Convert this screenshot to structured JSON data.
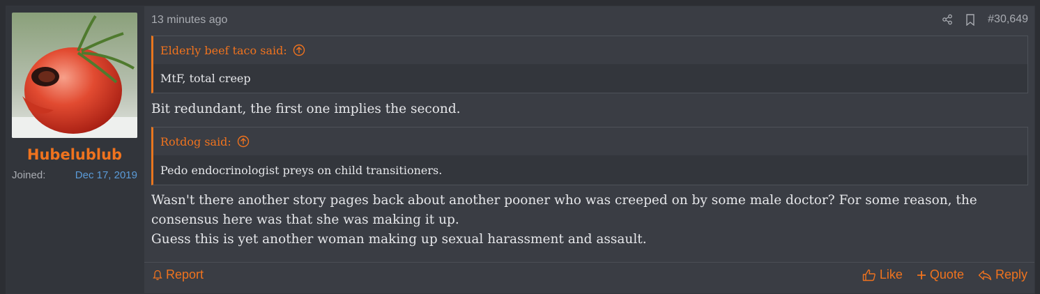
{
  "post": {
    "time": "13 minutes ago",
    "number": "#30,649",
    "icons": {
      "share": "share-icon",
      "bookmark": "bookmark-icon"
    },
    "user": {
      "name": "Hubelublub",
      "joined_label": "Joined:",
      "joined_date": "Dec 17, 2019",
      "avatar": "tomato-avatar"
    },
    "quotes": [
      {
        "author": "Elderly beef taco said:",
        "text": "MtF, total creep"
      },
      {
        "author": "Rotdog said:",
        "text": "Pedo endocrinologist preys on child transitioners."
      }
    ],
    "reply1": "Bit redundant, the first one implies the second.",
    "reply2_line1": "Wasn't there another story pages back about another pooner who was creeped on by some male doctor? For some reason, the",
    "reply2_line2": "consensus here was that she was making it up.",
    "reply2_line3": "Guess this is yet another woman making up sexual harassment and assault.",
    "footer": {
      "report": "Report",
      "like": "Like",
      "quote": "Quote",
      "reply": "Reply"
    },
    "colors": {
      "accent": "#f0731e",
      "link": "#5b9bd8",
      "bg": "#3a3d44"
    }
  }
}
